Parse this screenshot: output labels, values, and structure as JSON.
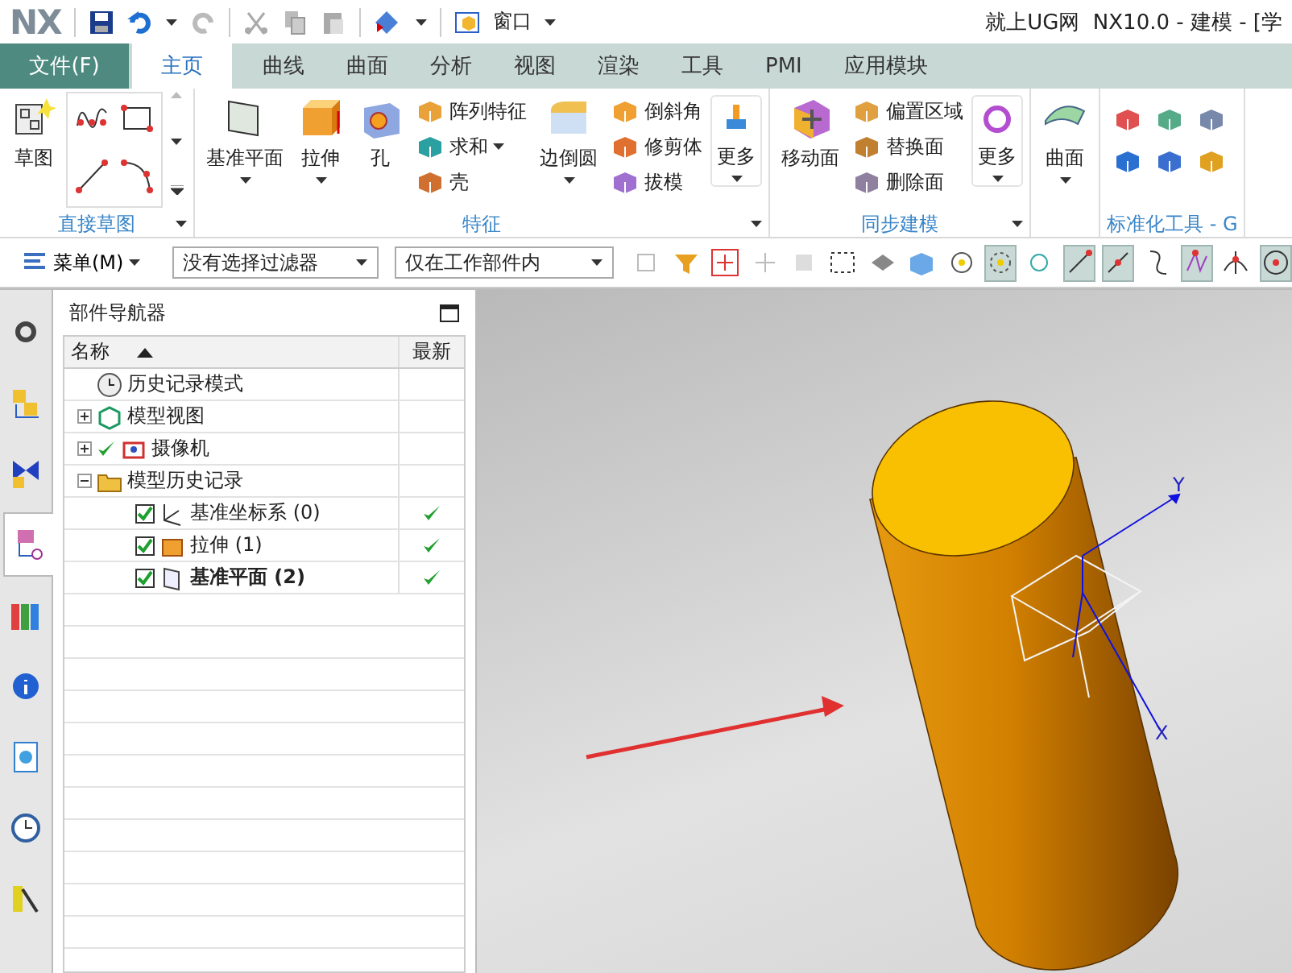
{
  "title_bar": {
    "logo": "NX",
    "quick_access_label": "窗口",
    "title": "就上UG网  NX10.0 - 建模 - [学"
  },
  "file_tab": "文件(F)",
  "tabs": [
    {
      "label": "主页",
      "selected": true
    },
    {
      "label": "曲线",
      "selected": false
    },
    {
      "label": "曲面",
      "selected": false
    },
    {
      "label": "分析",
      "selected": false
    },
    {
      "label": "视图",
      "selected": false
    },
    {
      "label": "渲染",
      "selected": false
    },
    {
      "label": "工具",
      "selected": false
    },
    {
      "label": "PMI",
      "selected": false
    },
    {
      "label": "应用模块",
      "selected": false
    }
  ],
  "ribbon": [
    {
      "label": "直接草图",
      "menu": true,
      "items": [
        {
          "kind": "large",
          "label": "草图",
          "dropdown": false
        },
        {
          "kind": "gallery"
        }
      ]
    },
    {
      "label": "特征",
      "menu": true,
      "items": [
        {
          "kind": "large",
          "label": "基准平面",
          "dropdown": true
        },
        {
          "kind": "large",
          "label": "拉伸",
          "dropdown": true
        },
        {
          "kind": "large",
          "label": "孔",
          "dropdown": false
        },
        {
          "kind": "stack",
          "items": [
            {
              "label": "阵列特征",
              "dropdown": false
            },
            {
              "label": "求和",
              "dropdown": true
            },
            {
              "label": "壳",
              "dropdown": false
            }
          ]
        },
        {
          "kind": "large",
          "label": "边倒圆",
          "dropdown": true
        },
        {
          "kind": "stack",
          "items": [
            {
              "label": "倒斜角",
              "dropdown": false
            },
            {
              "label": "修剪体",
              "dropdown": false
            },
            {
              "label": "拔模",
              "dropdown": false
            }
          ]
        },
        {
          "kind": "more",
          "label": "更多",
          "dropdown": true
        }
      ]
    },
    {
      "label": "同步建模",
      "menu": true,
      "items": [
        {
          "kind": "large",
          "label": "移动面",
          "dropdown": false
        },
        {
          "kind": "stack",
          "items": [
            {
              "label": "偏置区域",
              "dropdown": false
            },
            {
              "label": "替换面",
              "dropdown": false
            },
            {
              "label": "删除面",
              "dropdown": false
            }
          ]
        },
        {
          "kind": "more",
          "label": "更多",
          "dropdown": true
        }
      ]
    },
    {
      "items": [
        {
          "kind": "large",
          "label": "曲面",
          "dropdown": true
        }
      ]
    },
    {
      "label": "标准化工具 - G",
      "menu": false,
      "items": [
        {
          "kind": "icons"
        }
      ]
    }
  ],
  "toolbar": {
    "menu_label": "菜单(M)",
    "filters": [
      {
        "value": "没有选择过滤器"
      },
      {
        "value": "仅在工作部件内"
      }
    ],
    "tool_buttons": [
      {
        "on": false
      },
      {
        "on": false
      },
      {
        "on": false
      },
      {
        "on": false
      },
      {
        "on": false
      },
      {
        "on": false
      },
      {
        "on": false
      },
      {
        "on": false
      },
      {
        "on": false
      },
      {
        "on": true
      },
      {
        "on": false
      },
      {
        "on": true
      },
      {
        "on": true
      },
      {
        "on": false
      },
      {
        "on": true
      },
      {
        "on": false
      },
      {
        "on": true
      }
    ]
  },
  "sidebar": [
    {
      "selected": false
    },
    {
      "selected": false
    },
    {
      "selected": false
    },
    {
      "selected": true
    },
    {
      "selected": false
    },
    {
      "selected": false
    },
    {
      "selected": false
    },
    {
      "selected": false
    },
    {
      "selected": false
    }
  ],
  "navigator": {
    "title": "部件导航器",
    "columns": [
      "名称",
      "最新"
    ],
    "nodes": [
      {
        "label": "历史记录模式"
      },
      {
        "label": "模型视图",
        "expanded": false
      },
      {
        "label": "摄像机",
        "expanded": false,
        "checked": true
      },
      {
        "label": "模型历史记录",
        "expanded": true,
        "children": [
          {
            "label": "基准坐标系 (0)",
            "checked": true,
            "latest": true,
            "current": false
          },
          {
            "label": "拉伸 (1)",
            "checked": true,
            "latest": true,
            "current": false
          },
          {
            "label": "基准平面 (2)",
            "checked": true,
            "latest": true,
            "current": true
          }
        ]
      }
    ]
  },
  "viewport": {
    "axis_labels": [
      "Y",
      "X"
    ]
  }
}
